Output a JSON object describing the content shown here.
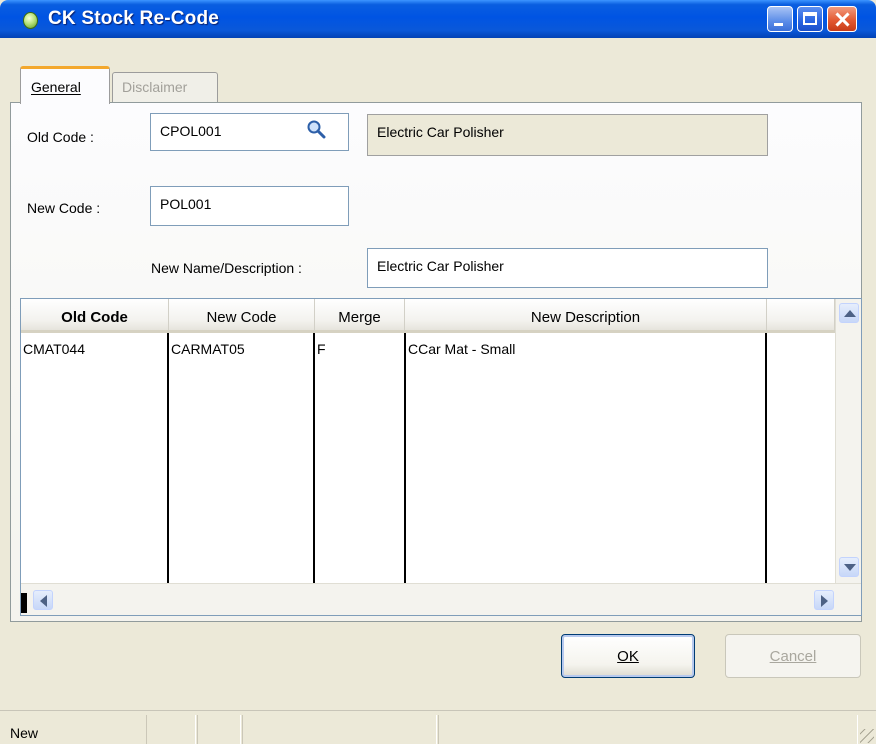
{
  "window": {
    "title": "CK Stock Re-Code"
  },
  "tabs": [
    {
      "label": "General",
      "accesskey": "G",
      "active": true
    },
    {
      "label": "Disclaimer",
      "accesskey": "D",
      "active": false
    }
  ],
  "form": {
    "old_code_label": "Old Code :",
    "old_code_value": "CPOL001",
    "old_code_description": "Electric Car Polisher",
    "new_code_label": "New Code :",
    "new_code_value": "POL001",
    "new_name_label": "New Name/Description :",
    "new_name_value": "Electric Car Polisher"
  },
  "grid": {
    "columns": [
      "Old Code",
      "New Code",
      "Merge",
      "New Description"
    ],
    "rows": [
      {
        "old_code": "CMAT044",
        "new_code": "CARMAT05",
        "merge": "F",
        "new_description": "CCar Mat - Small"
      }
    ]
  },
  "buttons": {
    "ok_label": "OK",
    "cancel_label": "Cancel"
  },
  "status": {
    "text": "New"
  },
  "icons": {
    "search": "search-icon",
    "app": "app-icon"
  },
  "colors": {
    "titlebar": "#0054e3",
    "active_tab_accent": "#f3a82e",
    "window_bg": "#ece9d8"
  }
}
